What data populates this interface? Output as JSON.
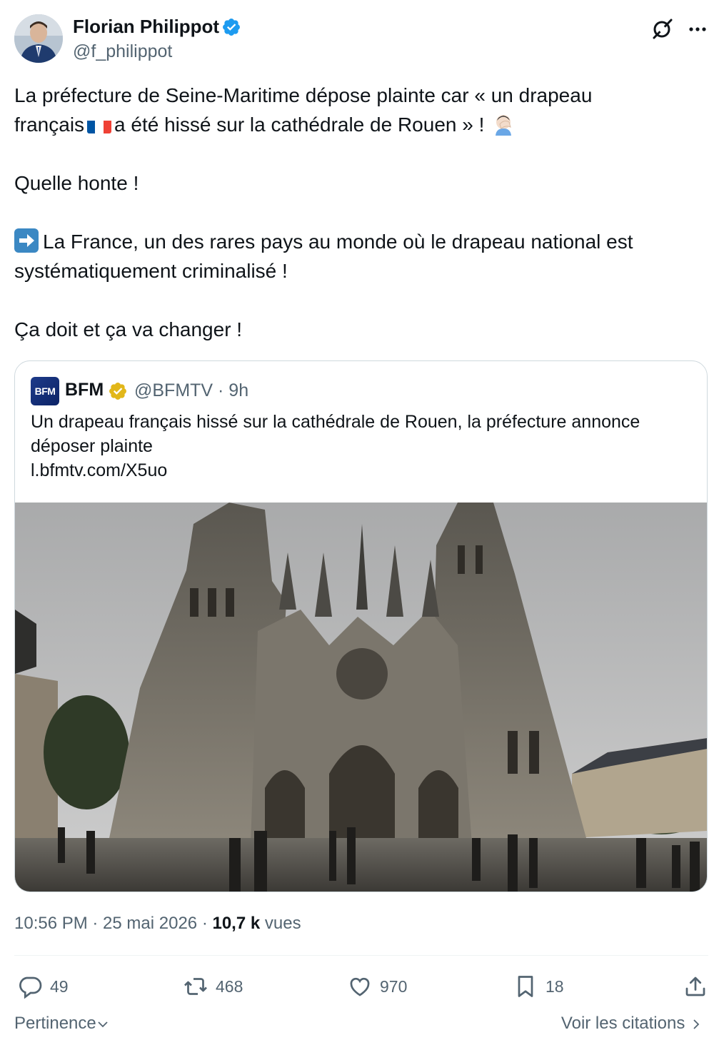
{
  "author": {
    "name": "Florian Philippot",
    "handle": "@f_philippot"
  },
  "tweet": {
    "line1": "La préfecture de Seine-Maritime dépose plainte car « un drapeau",
    "line2a": "français",
    "line2b": "a été hissé sur la cathédrale de Rouen » !",
    "line3": "Quelle honte !",
    "line4": "La France, un des rares pays au monde où le drapeau national est",
    "line5": "systématiquement criminalisé !",
    "line6": "Ça doit et ça va changer !"
  },
  "quote": {
    "logo_text": "BFM",
    "name": "BFM",
    "handle_time": "@BFMTV · 9h",
    "text_line1": "Un drapeau français hissé sur la cathédrale de Rouen, la préfecture annonce",
    "text_line2": "déposer plainte",
    "link": "l.bfmtv.com/X5uo"
  },
  "meta": {
    "time_date": "10:56 PM · 25 mai 2026 · ",
    "views_count": "10,7 k",
    "views_label": "vues"
  },
  "actions": {
    "replies": "49",
    "reposts": "468",
    "likes": "970",
    "bookmarks": "18"
  },
  "footer": {
    "sort_label": "Pertinence",
    "quotes_label": "Voir les citations"
  },
  "colors": {
    "verified_blue": "#1d9bf0",
    "verified_gold": "#e2b719",
    "secondary_text": "#536471"
  },
  "icons": [
    "verified-icon",
    "grok-icon",
    "more-icon",
    "reply-icon",
    "repost-icon",
    "like-icon",
    "bookmark-icon",
    "share-icon",
    "chevron-down-icon",
    "chevron-right-icon"
  ]
}
